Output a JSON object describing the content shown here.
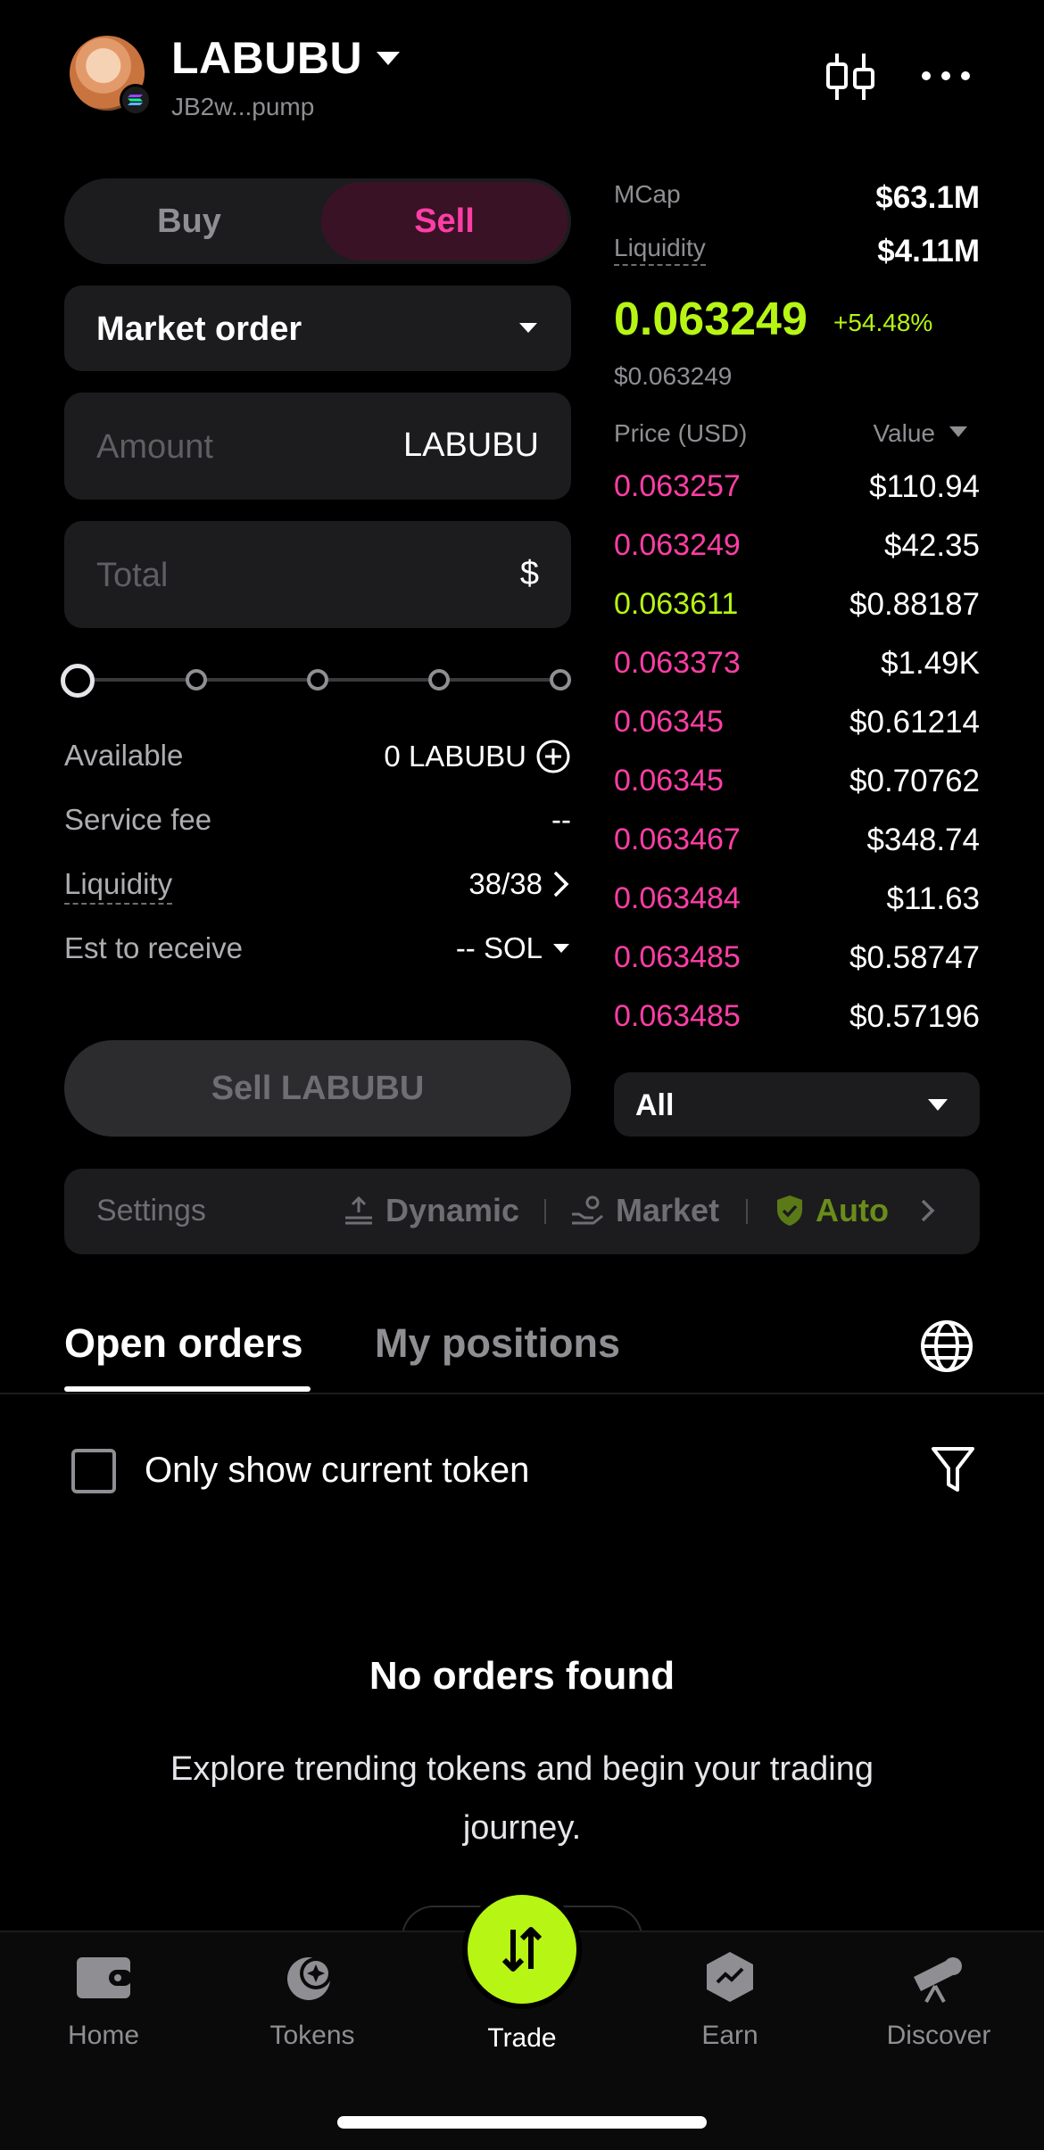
{
  "header": {
    "token_name": "LABUBU",
    "token_address": "JB2w...pump"
  },
  "trade_form": {
    "buy_label": "Buy",
    "sell_label": "Sell",
    "active_side": "Sell",
    "order_type": "Market order",
    "amount_placeholder": "Amount",
    "amount_unit": "LABUBU",
    "total_placeholder": "Total",
    "total_unit": "$",
    "slider_percent": 0,
    "available_label": "Available",
    "available_value": "0 LABUBU",
    "service_fee_label": "Service fee",
    "service_fee_value": "--",
    "liquidity_label": "Liquidity",
    "liquidity_value": "38/38",
    "receive_label": "Est to receive",
    "receive_value": "-- SOL",
    "submit_label": "Sell LABUBU"
  },
  "market_stats": {
    "mcap_label": "MCap",
    "mcap_value": "$63.1M",
    "liquidity_label": "Liquidity",
    "liquidity_value": "$4.11M",
    "price": "0.063249",
    "change": "+54.48%",
    "price_usd": "$0.063249"
  },
  "order_book": {
    "col_price": "Price (USD)",
    "col_value": "Value",
    "rows": [
      {
        "price": "0.063257",
        "value": "$110.94",
        "side": "sell"
      },
      {
        "price": "0.063249",
        "value": "$42.35",
        "side": "sell"
      },
      {
        "price": "0.063611",
        "value": "$0.88187",
        "side": "buy"
      },
      {
        "price": "0.063373",
        "value": "$1.49K",
        "side": "sell"
      },
      {
        "price": "0.06345",
        "value": "$0.61214",
        "side": "sell"
      },
      {
        "price": "0.06345",
        "value": "$0.70762",
        "side": "sell"
      },
      {
        "price": "0.063467",
        "value": "$348.74",
        "side": "sell"
      },
      {
        "price": "0.063484",
        "value": "$11.63",
        "side": "sell"
      },
      {
        "price": "0.063485",
        "value": "$0.58747",
        "side": "sell"
      },
      {
        "price": "0.063485",
        "value": "$0.57196",
        "side": "sell"
      }
    ],
    "filter": "All"
  },
  "settings_bar": {
    "label": "Settings",
    "slippage": "Dynamic",
    "execution": "Market",
    "protection": "Auto"
  },
  "orders": {
    "tab_open": "Open orders",
    "tab_positions": "My positions",
    "only_current_label": "Only show current token",
    "empty_title": "No orders found",
    "empty_subtitle": "Explore trending tokens and begin your trading journey."
  },
  "nav": {
    "items": [
      {
        "label": "Home",
        "icon": "wallet-icon"
      },
      {
        "label": "Tokens",
        "icon": "tokens-icon"
      },
      {
        "label": "Trade",
        "icon": "swap-icon"
      },
      {
        "label": "Earn",
        "icon": "earn-icon"
      },
      {
        "label": "Discover",
        "icon": "telescope-icon"
      }
    ]
  },
  "colors": {
    "accent_green": "#b6f514",
    "sell_pink": "#ff3ea5",
    "background": "#000000",
    "surface": "#1c1c1e"
  }
}
